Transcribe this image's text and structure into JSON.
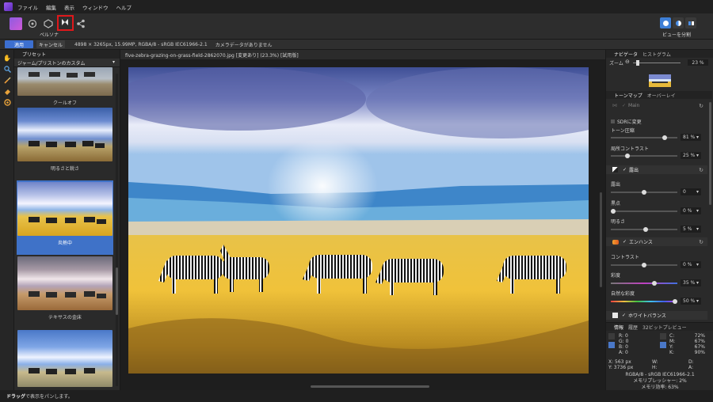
{
  "menubar": {
    "items": [
      "ファイル",
      "編集",
      "表示",
      "ウィンドウ",
      "ヘルプ"
    ]
  },
  "toolbar": {
    "persona_label": "ペルソナ",
    "view_split_label": "ビューを分割"
  },
  "context": {
    "apply_label": "適用",
    "cancel_label": "キャンセル",
    "image_info": "4898 × 3265px, 15.99MP, RGBA/8 - sRGB IEC61966-2.1",
    "metadata": "カメラデータがありません"
  },
  "left_panel": {
    "header": "プリセット",
    "category": "ジャーム/プリストンのカスタム",
    "presets": [
      {
        "label": "クールオフ",
        "selected": false
      },
      {
        "label": "明るさと鋭さ",
        "selected": false
      },
      {
        "label": "炎熱中",
        "selected": true
      },
      {
        "label": "テキサスの金床",
        "selected": false
      }
    ]
  },
  "document": {
    "tab_title": "five-zebra-grazing-on-grass-field-2862070.jpg [変更あり] (23.3%) [試用版]"
  },
  "navigator": {
    "tabs": [
      "ナビゲータ",
      "ヒストグラム"
    ],
    "zoom_label": "ズーム",
    "zoom_value": "23 %"
  },
  "adjust": {
    "tabs": [
      "トーンマップ",
      "オーバーレイ"
    ],
    "main_label": "Main",
    "sdr_label": "SDRに変更",
    "tone_compression_label": "トーン圧縮",
    "tone_compression_value": "81 %",
    "tone_compression_level": 0.81,
    "local_contrast_label": "局所コントラスト",
    "local_contrast_value": "25 %",
    "local_contrast_level": 0.25,
    "exposure_section": "露出",
    "exposure_label": "露出",
    "exposure_value": "0",
    "exposure_level": 0.5,
    "black_label": "黒点",
    "black_value": "0 %",
    "black_level": 0.0,
    "brightness_label": "明るさ",
    "brightness_value": "5 %",
    "brightness_level": 0.52,
    "enhance_section": "エンハンス",
    "contrast_label": "コントラスト",
    "contrast_value": "0 %",
    "contrast_level": 0.5,
    "saturation_label": "彩度",
    "saturation_value": "35 %",
    "saturation_level": 0.66,
    "vibrance_label": "自然な彩度",
    "vibrance_value": "50 %",
    "vibrance_level": 0.98,
    "white_balance_section": "ホワイトバランス"
  },
  "info_panel": {
    "tabs": [
      "情報",
      "履歴",
      "32ビットプレビュー"
    ],
    "r_label": "R:",
    "r_value": "0",
    "g_label": "G:",
    "g_value": "0",
    "b_label": "B:",
    "b_value": "0",
    "a_label": "A:",
    "a_value": "0",
    "c_label": "C:",
    "c_value": "72%",
    "m_label": "M:",
    "m_value": "67%",
    "y_label": "Y:",
    "y_value": "67%",
    "k_label": "K:",
    "k_value": "90%",
    "x_label": "X: 563 px",
    "ycoord_label": "Y: 3736 px",
    "w_label": "W:",
    "h_label": "H:",
    "d_label": "D:",
    "a2_label": "A:",
    "color_profile": "RGBA/8 - sRGB IEC61966-2.1",
    "memory_pressure": "メモリプレッシャー: 2%",
    "memory_efficiency": "メモリ効率: 63%"
  },
  "status": {
    "drag_word": "ドラッグ",
    "hint": "で表示をパンします。"
  },
  "colors": {
    "accent": "#3f72c8",
    "highlight_box": "#e0181b"
  }
}
